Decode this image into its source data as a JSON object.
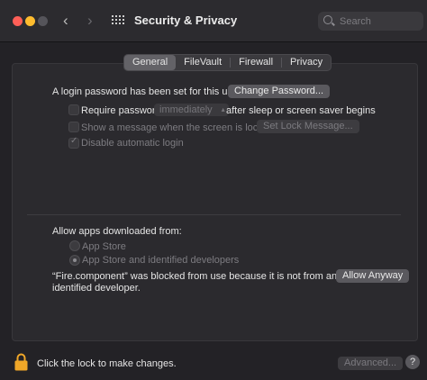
{
  "window": {
    "title": "Security & Privacy"
  },
  "search": {
    "placeholder": "Search"
  },
  "tabs": [
    {
      "label": "General",
      "active": true
    },
    {
      "label": "FileVault"
    },
    {
      "label": "Firewall"
    },
    {
      "label": "Privacy"
    }
  ],
  "general": {
    "login_text": "A login password has been set for this user",
    "change_password_label": "Change Password...",
    "require_password_label": "Require password",
    "require_password_value": "immediately",
    "require_password_suffix": "after sleep or screen saver begins",
    "show_message_label": "Show a message when the screen is locked",
    "set_lock_message_label": "Set Lock Message...",
    "disable_autologin_label": "Disable automatic login"
  },
  "downloads": {
    "heading": "Allow apps downloaded from:",
    "option_app_store": "App Store",
    "option_identified": "App Store and identified developers",
    "blocked_line1": "“Fire.component” was blocked from use because it is not from an",
    "blocked_line2": "identified developer.",
    "allow_anyway_label": "Allow Anyway"
  },
  "footer": {
    "lock_text": "Click the lock to make changes.",
    "advanced_label": "Advanced...",
    "help_label": "?"
  },
  "colors": {
    "background": "#232226",
    "lock": "#f0a728"
  }
}
